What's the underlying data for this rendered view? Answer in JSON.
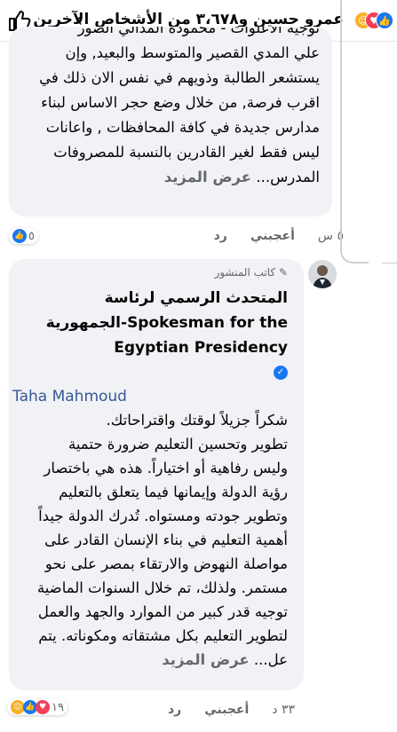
{
  "header": {
    "title": "عمرو حسين و٣،٦٧٨ من الأشخاص الآخرين",
    "back_icon": "chevron-left-icon",
    "like_icon": "thumbs-up-icon"
  },
  "comment1": {
    "lines": [
      "توجيه الاعلوات - محموده المدالي الصور",
      "علي المدي القصير والمتوسط والبعيد, وإن",
      "يستشعر الطالبة وذويهم في نفس الان ذلك في",
      "اقرب فرصة, من خلال وضع حجر الاساس لبناء",
      "مدارس جديدة في كافة المحافظات , واعانات",
      "ليس فقط لغير القادرين بالنسبة للمصروفات",
      "المدرس..."
    ],
    "see_more": "عرض المزيد",
    "time": "٥ س",
    "like_label": "أعجبني",
    "reply_label": "رد",
    "reaction_count": "٥"
  },
  "comment2": {
    "author_badge": "كاتب المنشور",
    "author_name_lines": [
      "المتحدث الرسمي لرئاسة",
      "Spokesman for the-الجمهورية",
      "Egyptian Presidency"
    ],
    "tagged": "Taha Mahmoud",
    "body_lines": [
      "شكراً جزيلاً لوقتك واقتراحاتك.",
      "تطوير وتحسين التعليم ضرورة حتمية",
      "وليس رفاهية أو اختياراً. هذه هي باختصار",
      "رؤية الدولة وإيمانها فيما يتعلق بالتعليم",
      "وتطوير جودته ومستواه. تُدرك الدولة جيداً",
      "أهمية التعليم في بناء الإنسان القادر على",
      "مواصلة النهوض والارتقاء بمصر على نحو",
      "مستمر. ولذلك، تم خلال السنوات الماضية",
      "توجيه قدر كبير من الموارد والجهد والعمل",
      "لتطوير التعليم بكل مشتقاته ومكوناته. يتم",
      "عل..."
    ],
    "see_more": "عرض المزيد",
    "time": "٣٣ د",
    "like_label": "أعجبني",
    "reply_label": "رد",
    "reaction_count": "١٩"
  },
  "colors": {
    "facebook_blue": "#1877f2",
    "love_red": "#f33e58",
    "care_yellow": "#f7b125",
    "bubble_gray": "#f0f2f5",
    "secondary_text": "#65676b"
  }
}
